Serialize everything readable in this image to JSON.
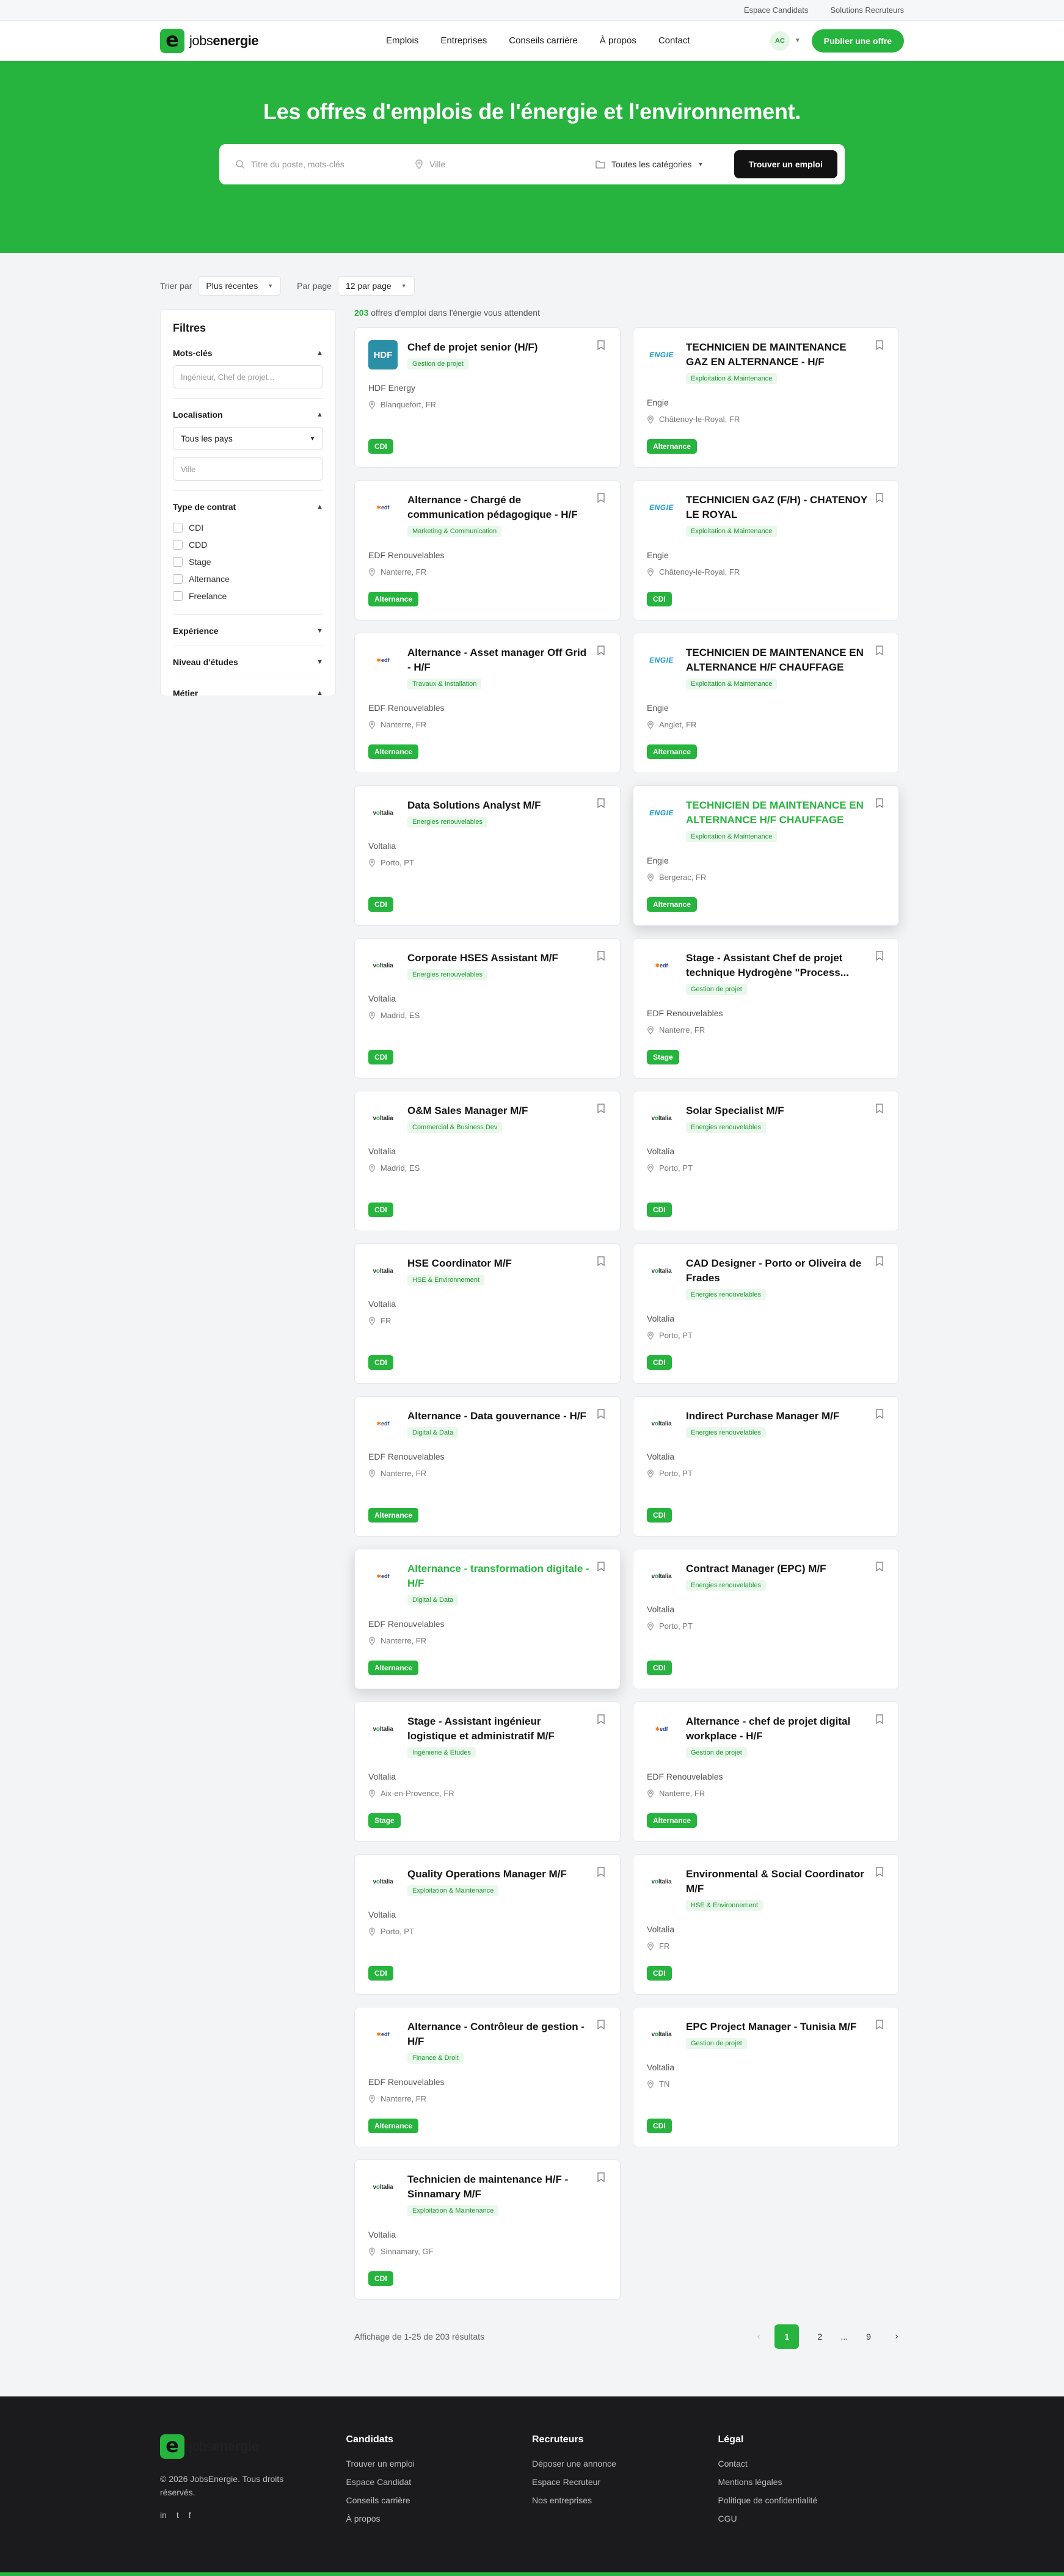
{
  "topbar": {
    "links": [
      "Espace Candidats",
      "Solutions Recruteurs"
    ]
  },
  "header": {
    "logo_light": "jobs",
    "logo_bold": "energie",
    "logo_mark": "e",
    "nav": [
      "Emplois",
      "Entreprises",
      "Conseils carrière",
      "À propos",
      "Contact"
    ],
    "avatar": "AC",
    "publish": "Publier une offre"
  },
  "hero": {
    "title": "Les offres d'emplois de l'énergie et l'environnement.",
    "keyword_placeholder": "Titre du poste, mots-clés",
    "city_placeholder": "Ville",
    "category": "Toutes les catégories",
    "button": "Trouver un emploi"
  },
  "sort": {
    "sort_label": "Trier par",
    "sort_value": "Plus récentes",
    "perpage_label": "Par page",
    "perpage_value": "12 par page"
  },
  "filters": {
    "title": "Filtres",
    "keywords": {
      "label": "Mots-clés",
      "placeholder": "Ingénieur, Chef de projet..."
    },
    "location": {
      "label": "Localisation",
      "country": "Tous les pays",
      "city_placeholder": "Ville"
    },
    "contract": {
      "label": "Type de contrat",
      "options": [
        "CDI",
        "CDD",
        "Stage",
        "Alternance",
        "Freelance"
      ]
    },
    "experience": "Expérience",
    "education": "Niveau d'études",
    "job": "Métier"
  },
  "results": {
    "count": "203",
    "count_text": " offres d'emploi dans l'énergie vous attendent"
  },
  "jobs": [
    {
      "title": "Chef de projet senior (H/F)",
      "tag": "Gestion de projet",
      "company": "HDF Energy",
      "location": "Blanquefort, FR",
      "contract": "CDI",
      "logo": "HDF"
    },
    {
      "title": "TECHNICIEN DE MAINTENANCE GAZ EN ALTERNANCE - H/F",
      "tag": "Exploitation & Maintenance",
      "company": "Engie",
      "location": "Châtenoy-le-Royal, FR",
      "contract": "Alternance",
      "logo": "engie"
    },
    {
      "title": "Alternance - Chargé de communication pédagogique - H/F",
      "tag": "Marketing & Communication",
      "company": "EDF Renouvelables",
      "location": "Nanterre, FR",
      "contract": "Alternance",
      "logo": "edf"
    },
    {
      "title": "TECHNICIEN GAZ (F/H) - CHATENOY LE ROYAL",
      "tag": "Exploitation & Maintenance",
      "company": "Engie",
      "location": "Châtenoy-le-Royal, FR",
      "contract": "CDI",
      "logo": "engie"
    },
    {
      "title": "Alternance - Asset manager Off Grid - H/F",
      "tag": "Travaux & Installation",
      "company": "EDF Renouvelables",
      "location": "Nanterre, FR",
      "contract": "Alternance",
      "logo": "edf"
    },
    {
      "title": "TECHNICIEN DE MAINTENANCE EN ALTERNANCE H/F CHAUFFAGE",
      "tag": "Exploitation & Maintenance",
      "company": "Engie",
      "location": "Anglet, FR",
      "contract": "Alternance",
      "logo": "engie"
    },
    {
      "title": "Data Solutions Analyst M/F",
      "tag": "Energies renouvelables",
      "company": "Voltalia",
      "location": "Porto, PT",
      "contract": "CDI",
      "logo": "voltalia"
    },
    {
      "title": "TECHNICIEN DE MAINTENANCE EN ALTERNANCE H/F CHAUFFAGE",
      "tag": "Exploitation & Maintenance",
      "company": "Engie",
      "location": "Bergerac, FR",
      "contract": "Alternance",
      "logo": "engie",
      "hover": true
    },
    {
      "title": "Corporate HSES Assistant M/F",
      "tag": "Energies renouvelables",
      "company": "Voltalia",
      "location": "Madrid, ES",
      "contract": "CDI",
      "logo": "voltalia"
    },
    {
      "title": "Stage - Assistant Chef de projet technique Hydrogène \"Process...",
      "tag": "Gestion de projet",
      "company": "EDF Renouvelables",
      "location": "Nanterre, FR",
      "contract": "Stage",
      "logo": "edf"
    },
    {
      "title": "O&M Sales Manager M/F",
      "tag": "Commercial & Business Dev",
      "company": "Voltalia",
      "location": "Madrid, ES",
      "contract": "CDI",
      "logo": "voltalia"
    },
    {
      "title": "Solar Specialist M/F",
      "tag": "Energies renouvelables",
      "company": "Voltalia",
      "location": "Porto, PT",
      "contract": "CDI",
      "logo": "voltalia"
    },
    {
      "title": "HSE Coordinator M/F",
      "tag": "HSE & Environnement",
      "company": "Voltalia",
      "location": "FR",
      "contract": "CDI",
      "logo": "voltalia"
    },
    {
      "title": "CAD Designer - Porto or Oliveira de Frades",
      "tag": "Energies renouvelables",
      "company": "Voltalia",
      "location": "Porto, PT",
      "contract": "CDI",
      "logo": "voltalia"
    },
    {
      "title": "Alternance - Data gouvernance - H/F",
      "tag": "Digital & Data",
      "company": "EDF Renouvelables",
      "location": "Nanterre, FR",
      "contract": "Alternance",
      "logo": "edf"
    },
    {
      "title": "Indirect Purchase Manager M/F",
      "tag": "Energies renouvelables",
      "company": "Voltalia",
      "location": "Porto, PT",
      "contract": "CDI",
      "logo": "voltalia"
    },
    {
      "title": "Alternance - transformation digitale - H/F",
      "tag": "Digital & Data",
      "company": "EDF Renouvelables",
      "location": "Nanterre, FR",
      "contract": "Alternance",
      "logo": "edf",
      "hover": true
    },
    {
      "title": "Contract Manager (EPC) M/F",
      "tag": "Energies renouvelables",
      "company": "Voltalia",
      "location": "Porto, PT",
      "contract": "CDI",
      "logo": "voltalia"
    },
    {
      "title": "Stage - Assistant ingénieur logistique et administratif M/F",
      "tag": "Ingénierie & Etudes",
      "company": "Voltalia",
      "location": "Aix-en-Provence, FR",
      "contract": "Stage",
      "logo": "voltalia"
    },
    {
      "title": "Alternance - chef de projet digital workplace - H/F",
      "tag": "Gestion de projet",
      "company": "EDF Renouvelables",
      "location": "Nanterre, FR",
      "contract": "Alternance",
      "logo": "edf"
    },
    {
      "title": "Quality Operations Manager M/F",
      "tag": "Exploitation & Maintenance",
      "company": "Voltalia",
      "location": "Porto, PT",
      "contract": "CDI",
      "logo": "voltalia"
    },
    {
      "title": "Environmental & Social Coordinator M/F",
      "tag": "HSE & Environnement",
      "company": "Voltalia",
      "location": "FR",
      "contract": "CDI",
      "logo": "voltalia"
    },
    {
      "title": "Alternance - Contrôleur de gestion - H/F",
      "tag": "Finance & Droit",
      "company": "EDF Renouvelables",
      "location": "Nanterre, FR",
      "contract": "Alternance",
      "logo": "edf"
    },
    {
      "title": "EPC Project Manager - Tunisia M/F",
      "tag": "Gestion de projet",
      "company": "Voltalia",
      "location": "TN",
      "contract": "CDI",
      "logo": "voltalia"
    },
    {
      "title": "Technicien de maintenance H/F - Sinnamary M/F",
      "tag": "Exploitation & Maintenance",
      "company": "Voltalia",
      "location": "Sinnamary, GF",
      "contract": "CDI",
      "logo": "voltalia"
    }
  ],
  "pagination": {
    "info": "Affichage de 1-25 de 203 résultats",
    "pages": [
      "1",
      "2",
      "...",
      "9"
    ]
  },
  "footer": {
    "copyright": "© 2026 JobsEnergie. Tous droits réservés.",
    "social": [
      "in",
      "t",
      "f"
    ],
    "columns": [
      {
        "title": "Candidats",
        "links": [
          "Trouver un emploi",
          "Espace Candidat",
          "Conseils carrière",
          "À propos"
        ]
      },
      {
        "title": "Recruteurs",
        "links": [
          "Déposer une annonce",
          "Espace Recruteur",
          "Nos entreprises"
        ]
      },
      {
        "title": "Légal",
        "links": [
          "Contact",
          "Mentions légales",
          "Politique de confidentialité",
          "CGU"
        ]
      }
    ]
  },
  "colors": {
    "brand": "#27b43e",
    "dark": "#1b1b1d"
  }
}
